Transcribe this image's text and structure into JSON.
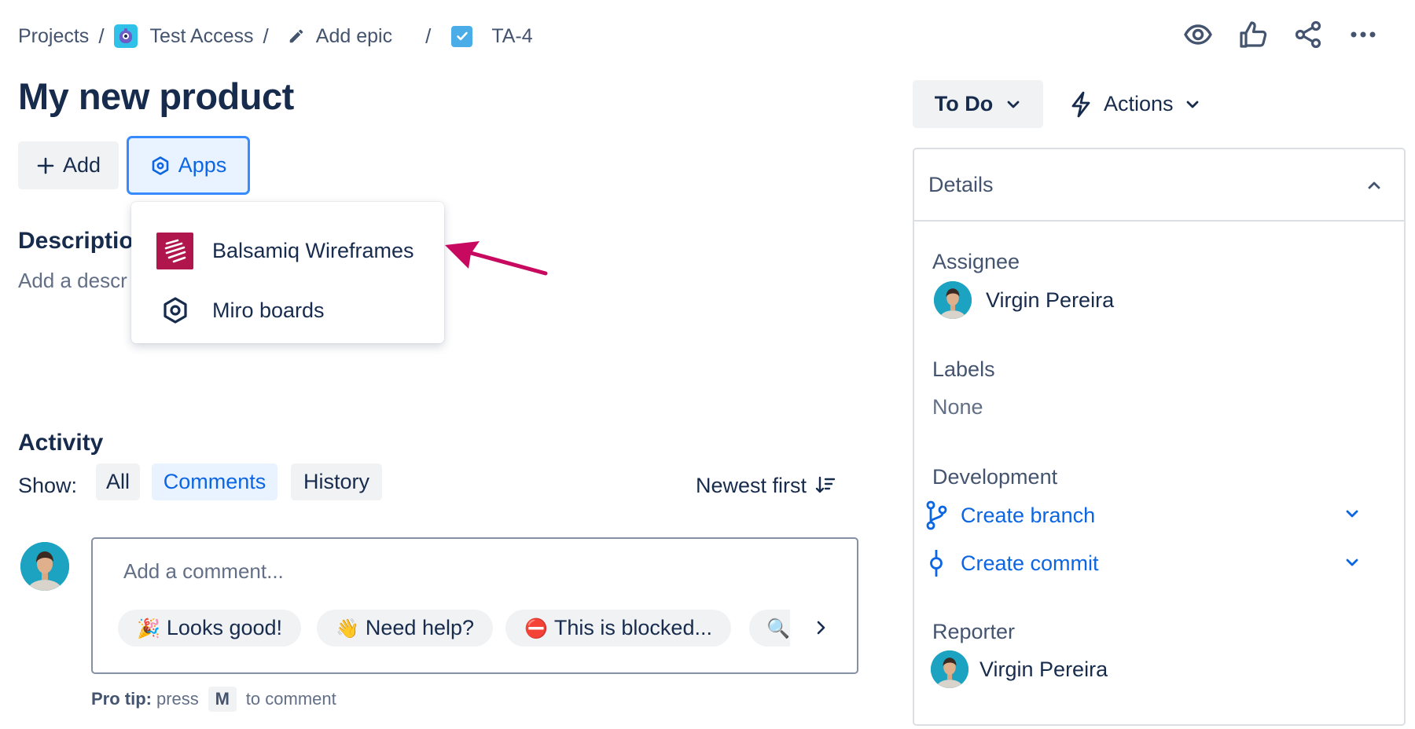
{
  "breadcrumb": {
    "projects": "Projects",
    "sep": "/",
    "project_name": "Test Access",
    "epic": "Add epic",
    "issue_key": "TA-4"
  },
  "issue": {
    "title": "My new product",
    "add_label": "Add",
    "apps_label": "Apps"
  },
  "apps_menu": {
    "items": [
      {
        "label": "Balsamiq Wireframes",
        "icon": "balsamiq-logo"
      },
      {
        "label": "Miro boards",
        "icon": "hexagon-app-icon"
      }
    ]
  },
  "description": {
    "heading": "Descriptio",
    "placeholder": "Add a descr"
  },
  "activity": {
    "heading": "Activity",
    "show_label": "Show:",
    "filters": [
      "All",
      "Comments",
      "History"
    ],
    "selected_filter": "Comments",
    "sort_label": "Newest first"
  },
  "comment": {
    "placeholder": "Add a comment...",
    "quick_replies": [
      {
        "emoji": "🎉",
        "label": "Looks good!"
      },
      {
        "emoji": "👋",
        "label": "Need help?"
      },
      {
        "emoji": "⛔",
        "label": "This is blocked..."
      },
      {
        "emoji": "🔍",
        "label": ""
      }
    ],
    "pro_tip_prefix": "Pro tip:",
    "pro_tip_press": "press",
    "pro_tip_key": "M",
    "pro_tip_suffix": "to comment"
  },
  "status": {
    "label": "To Do",
    "actions_label": "Actions"
  },
  "details": {
    "title": "Details",
    "assignee_label": "Assignee",
    "assignee_name": "Virgin Pereira",
    "labels_label": "Labels",
    "labels_value": "None",
    "development_label": "Development",
    "create_branch": "Create branch",
    "create_commit": "Create commit",
    "reporter_label": "Reporter",
    "reporter_name": "Virgin Pereira"
  },
  "colors": {
    "link_blue": "#0c66e4",
    "text_primary": "#172b4d",
    "text_subtle": "#44546f",
    "neutral_bg": "#f1f2f4",
    "selected_bg": "#e9f2ff",
    "arrow_magenta": "#c70a5f",
    "balsamiq_brand": "#b0154b"
  }
}
